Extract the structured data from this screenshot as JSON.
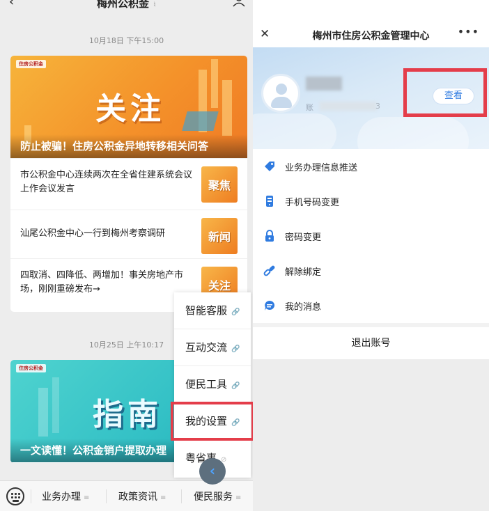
{
  "left": {
    "title": "梅州公积金",
    "timestamp1": "10月18日 下午15:00",
    "article1": {
      "banner_logo": "住房公积金",
      "banner_big": "关注",
      "banner_caption": "防止被骗！住房公积金异地转移相关问答"
    },
    "news": [
      {
        "text": "市公积金中心连续两次在全省住建系统会议上作会议发言",
        "thumb": "聚焦"
      },
      {
        "text": "汕尾公积金中心一行到梅州考察调研",
        "thumb": "新闻"
      },
      {
        "text": "四取消、四降低、两增加！事关房地产市场，刚刚重磅发布→",
        "thumb": "关注"
      }
    ],
    "timestamp2": "10月25日 上午10:17",
    "article2": {
      "banner_logo": "住房公积金",
      "banner_big": "指南",
      "banner_caption": "一文读懂！公积金销户提取办理"
    },
    "popup_menu": [
      "智能客服",
      "互动交流",
      "便民工具",
      "我的设置",
      "粤省事"
    ],
    "bottom_tabs": [
      "业务办理",
      "政策资讯",
      "便民服务"
    ]
  },
  "right": {
    "title": "梅州市住房公积金管理中心",
    "account_prefix": "账",
    "account_tail": "3",
    "view_button": "查看",
    "menu": [
      {
        "label": "业务办理信息推送",
        "icon": "tag-icon"
      },
      {
        "label": "手机号码变更",
        "icon": "phone-icon"
      },
      {
        "label": "密码变更",
        "icon": "lock-icon"
      },
      {
        "label": "解除绑定",
        "icon": "link-icon"
      },
      {
        "label": "我的消息",
        "icon": "message-icon"
      }
    ],
    "logout": "退出账号"
  },
  "colors": {
    "highlight_red": "#e43d4a",
    "accent_blue": "#2f7be0"
  }
}
